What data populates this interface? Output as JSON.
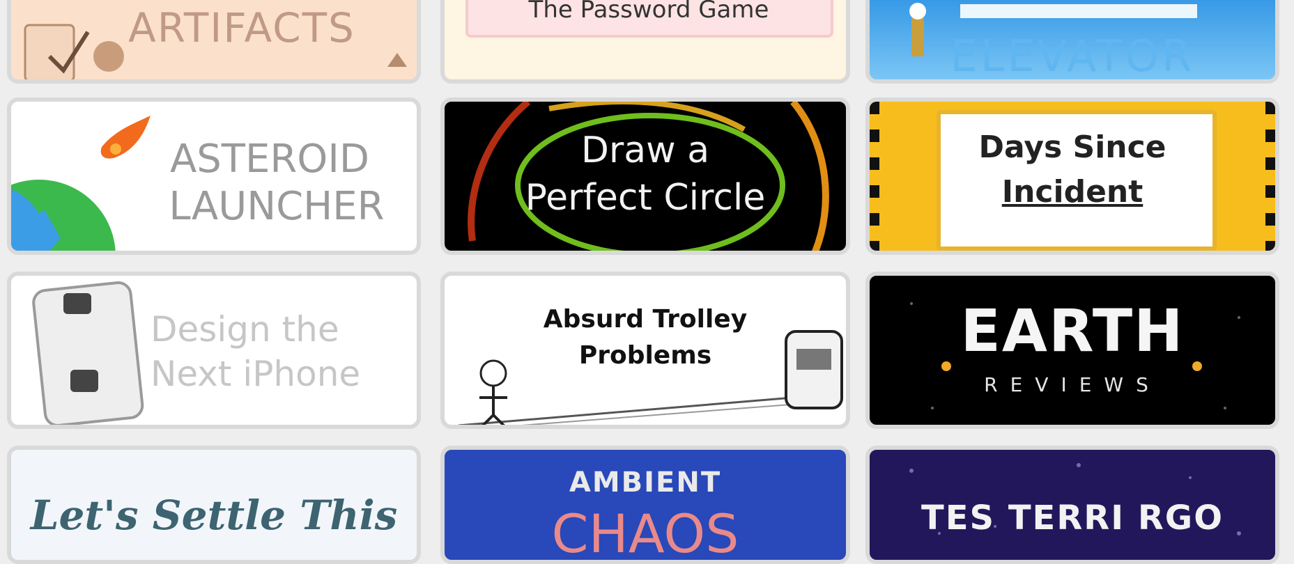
{
  "tiles": {
    "artifacts": {
      "title": "ARTIFACTS"
    },
    "password": {
      "title": "The Password Game"
    },
    "elevator": {
      "title": "ELEVATOR"
    },
    "asteroid": {
      "line1": "ASTEROID",
      "line2": "LAUNCHER"
    },
    "circle": {
      "line1": "Draw a",
      "line2": "Perfect Circle"
    },
    "stare": {
      "line1": "Days Since",
      "line2": "Incident"
    },
    "iphone": {
      "line1": "Design the",
      "line2": "Next iPhone"
    },
    "trolley": {
      "line1": "Absurd Trolley",
      "line2": "Problems"
    },
    "earth": {
      "line1": "EARTH",
      "line2": "REVIEWS"
    },
    "settle": {
      "title": "Let's Settle This"
    },
    "ambient": {
      "line1": "AMBIENT",
      "line2": "CHAOS"
    },
    "terra": {
      "title": "TES TERRI RGO"
    }
  },
  "colors": {
    "background": "#eeeeee",
    "tile_border": "#d9d9d9",
    "artifacts_bg": "#fbe1cc",
    "password_bg": "#fef5e2",
    "asteroid_earth_blue": "#3b9de6",
    "asteroid_earth_green": "#3cb94c",
    "asteroid_meteor": "#f26a1b",
    "stare_yellow": "#f7bd1d",
    "ambient_blue": "#2948b9",
    "ambient_pink": "#e98a8a",
    "terra_purple": "#23175c"
  }
}
